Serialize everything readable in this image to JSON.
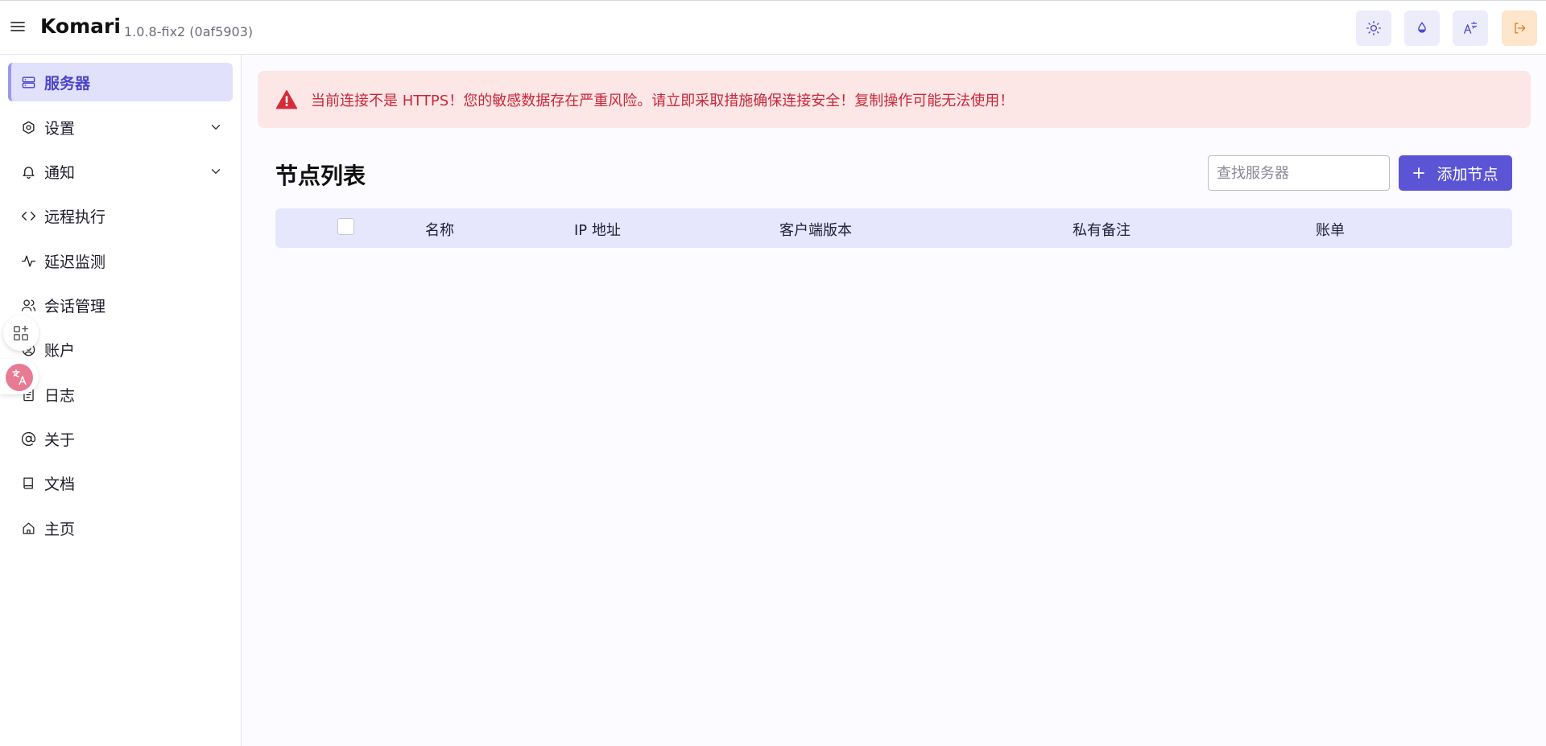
{
  "header": {
    "app_title": "Komari",
    "version": "1.0.8-fix2 (0af5903)",
    "icons": [
      "menu-icon",
      "sun-icon",
      "droplet-icon",
      "translate-icon",
      "logout-icon"
    ]
  },
  "sidebar": {
    "items": [
      {
        "label": "服务器",
        "icon": "server-icon",
        "active": true
      },
      {
        "label": "设置",
        "icon": "settings-icon",
        "expandable": true
      },
      {
        "label": "通知",
        "icon": "bell-icon",
        "expandable": true
      },
      {
        "label": "远程执行",
        "icon": "code-icon"
      },
      {
        "label": "延迟监测",
        "icon": "activity-icon"
      },
      {
        "label": "会话管理",
        "icon": "users-icon"
      },
      {
        "label": "账户",
        "icon": "user-circle-icon"
      },
      {
        "label": "日志",
        "icon": "file-text-icon"
      },
      {
        "label": "关于",
        "icon": "at-sign-icon"
      },
      {
        "label": "文档",
        "icon": "book-icon"
      },
      {
        "label": "主页",
        "icon": "home-icon"
      }
    ]
  },
  "alert": {
    "message": "当前连接不是 HTTPS！您的敏感数据存在严重风险。请立即采取措施确保连接安全！复制操作可能无法使用！",
    "color": "#c8283a"
  },
  "main": {
    "title": "节点列表",
    "search_placeholder": "查找服务器",
    "add_button": "添加节点",
    "columns": [
      "名称",
      "IP 地址",
      "客户端版本",
      "私有备注",
      "账单"
    ]
  },
  "colors": {
    "accent": "#5b55d6",
    "active_bg": "#e2e1fb",
    "table_head_bg": "#e6e6fc",
    "alert_bg": "#fde6e6"
  }
}
